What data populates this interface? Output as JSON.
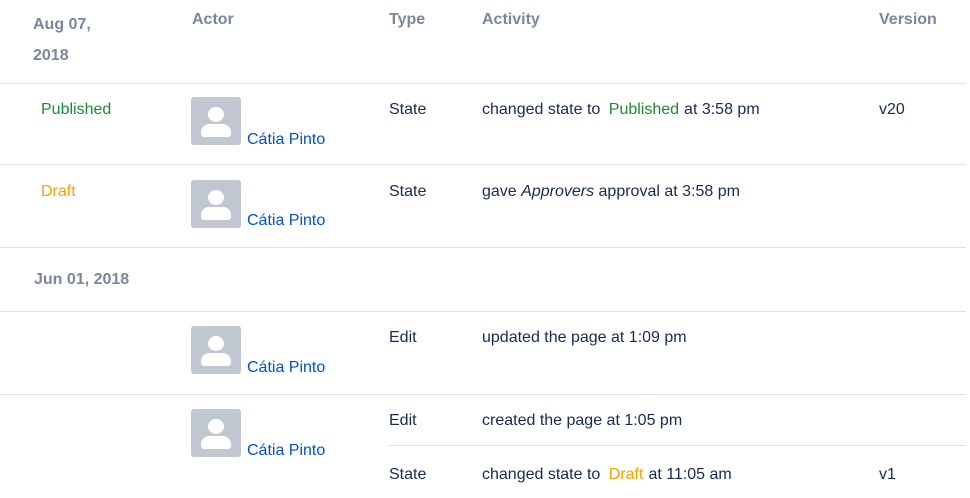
{
  "header": {
    "date_label": "Aug 07,\n2018",
    "date_line1": "Aug 07,",
    "date_line2": "2018",
    "actor": "Actor",
    "type": "Type",
    "activity": "Activity",
    "version": "Version"
  },
  "colors": {
    "published": "#1d8a33",
    "draft": "#f5a100",
    "link": "#0052cc",
    "header": "#7a869a",
    "divider": "#dfe1e6"
  },
  "group2_date": "Jun 01, 2018",
  "rows": [
    {
      "state": "Published",
      "actor": "Cátia Pinto",
      "type": "State",
      "activity_prefix": "changed state to",
      "activity_state": "Published",
      "activity_suffix": "at 3:58 pm",
      "version": "v20"
    },
    {
      "state": "Draft",
      "actor": "Cátia Pinto",
      "type": "State",
      "activity_prefix": "gave",
      "activity_italic": "Approvers",
      "activity_suffix": "approval at 3:58 pm",
      "version": ""
    },
    {
      "state": "",
      "actor": "Cátia Pinto",
      "type": "Edit",
      "activity": "updated the page at 1:09 pm",
      "version": ""
    },
    {
      "state": "",
      "actor": "Cátia Pinto",
      "type": "Edit",
      "activity": "created the page at 1:05 pm",
      "version": "",
      "sub": {
        "type": "State",
        "activity_prefix": "changed state to",
        "activity_state": "Draft",
        "activity_suffix": "at 11:05 am",
        "version": "v1"
      }
    }
  ]
}
